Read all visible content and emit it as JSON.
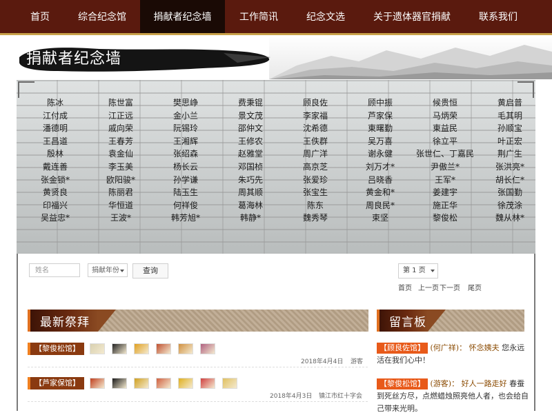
{
  "nav": {
    "items": [
      {
        "label": "首页"
      },
      {
        "label": "综合纪念馆"
      },
      {
        "label": "捐献者纪念墙"
      },
      {
        "label": "工作简讯"
      },
      {
        "label": "纪念文选"
      },
      {
        "label": "关于遗体器官捐献"
      },
      {
        "label": "联系我们"
      }
    ],
    "active": "捐献者纪念墙"
  },
  "banner": {
    "title": "捐献者纪念墙"
  },
  "wall": {
    "rows": [
      [
        "陈冰",
        "陈世富",
        "樊思峥",
        "费秉锟",
        "顾良佐",
        "顾中振",
        "候贵恒",
        "黄启普"
      ],
      [
        "江付成",
        "江正远",
        "金小兰",
        "景文茂",
        "李家福",
        "芦家保",
        "马炳荣",
        "毛其明"
      ],
      [
        "潘德明",
        "戚向荣",
        "阮锡玲",
        "邵仲文",
        "沈希德",
        "東曙勤",
        "東益民",
        "孙顺宝"
      ],
      [
        "王昌道",
        "王春芳",
        "王湘辉",
        "王修农",
        "王佚群",
        "吴万喜",
        "徐立平",
        "叶正宏"
      ],
      [
        "殷林",
        "袁金仙",
        "张绍森",
        "赵雅堂",
        "周广洋",
        "谢永健",
        "张世仁、丁嘉民",
        "荆广生"
      ],
      [
        "戴连善",
        "李玉美",
        "杨长云",
        "邓国桢",
        "高京芝",
        "刘万才*",
        "尹傲兰*",
        "张洪亮*"
      ],
      [
        "张金锁*",
        "欧阳骏*",
        "孙学谦",
        "朱巧先",
        "张爱珍",
        "吕晓香",
        "王军*",
        "胡长仁*"
      ],
      [
        "黄贤良",
        "陈丽君",
        "陆玉生",
        "周其顺",
        "张宝生",
        "黄金和*",
        "姜建宇",
        "张国勤"
      ],
      [
        "印福兴",
        "华恒道",
        "何祥俊",
        "葛海林",
        "陈东",
        "周良民*",
        "施正华",
        "徐茂涂"
      ],
      [
        "吴益忠*",
        "王波*",
        "韩芳旭*",
        "韩静*",
        "魏秀琴",
        "束坚",
        "黎俊松",
        "魏从林*"
      ]
    ]
  },
  "search": {
    "name_placeholder": "姓名",
    "year_placeholder": "捐献年份",
    "button": "查询"
  },
  "pagination": {
    "current": "第 1 页",
    "first": "首页",
    "prev": "上一页",
    "next": "下一页",
    "last": "尾页"
  },
  "worship": {
    "title": "最新祭拜",
    "entries": [
      {
        "hall": "【黎俊松馆】",
        "date": "2018年4月4日",
        "visitor": "游客"
      },
      {
        "hall": "【芦家保馆】",
        "date": "2018年4月3日",
        "visitor": "镇江市红十字会"
      }
    ]
  },
  "messages": {
    "title": "留言板",
    "items": [
      {
        "hall": "【顾良佐馆】",
        "author": "(何广祥)：",
        "headline": "怀念姨夫",
        "body": "您永远活在我们心中！"
      },
      {
        "hall": "【黎俊松馆】",
        "author": "(游客)：",
        "headline": "好人一路走好",
        "body": "春蚕到死丝方尽，点燃蜡烛照亮他人者，也会给自己带来光明。"
      }
    ]
  },
  "colors": {
    "nav_bg": "#5a1a0e",
    "nav_active": "#1a0a05",
    "accent_orange": "#e85a1a",
    "section_brown": "#6a2a10"
  }
}
